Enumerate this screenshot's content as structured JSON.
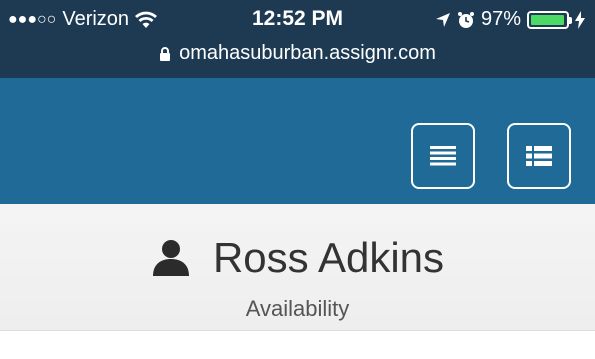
{
  "status_bar": {
    "signal_dots": "●●●○○",
    "carrier": "Verizon",
    "time": "12:52 PM",
    "battery_percent": "97%",
    "battery_level": 0.97,
    "battery_color": "#4cd964",
    "icons": [
      "wifi-icon",
      "location-arrow-icon",
      "alarm-icon",
      "battery-icon",
      "charging-icon"
    ]
  },
  "browser": {
    "url": "omahasuburban.assignr.com",
    "lock_icon": "lock-icon"
  },
  "navbar": {
    "color": "#1f6a96",
    "buttons": [
      {
        "icon": "menu-icon"
      },
      {
        "icon": "list-icon"
      }
    ]
  },
  "profile": {
    "name": "Ross Adkins",
    "subtitle": "Availability",
    "icon": "user-icon"
  }
}
